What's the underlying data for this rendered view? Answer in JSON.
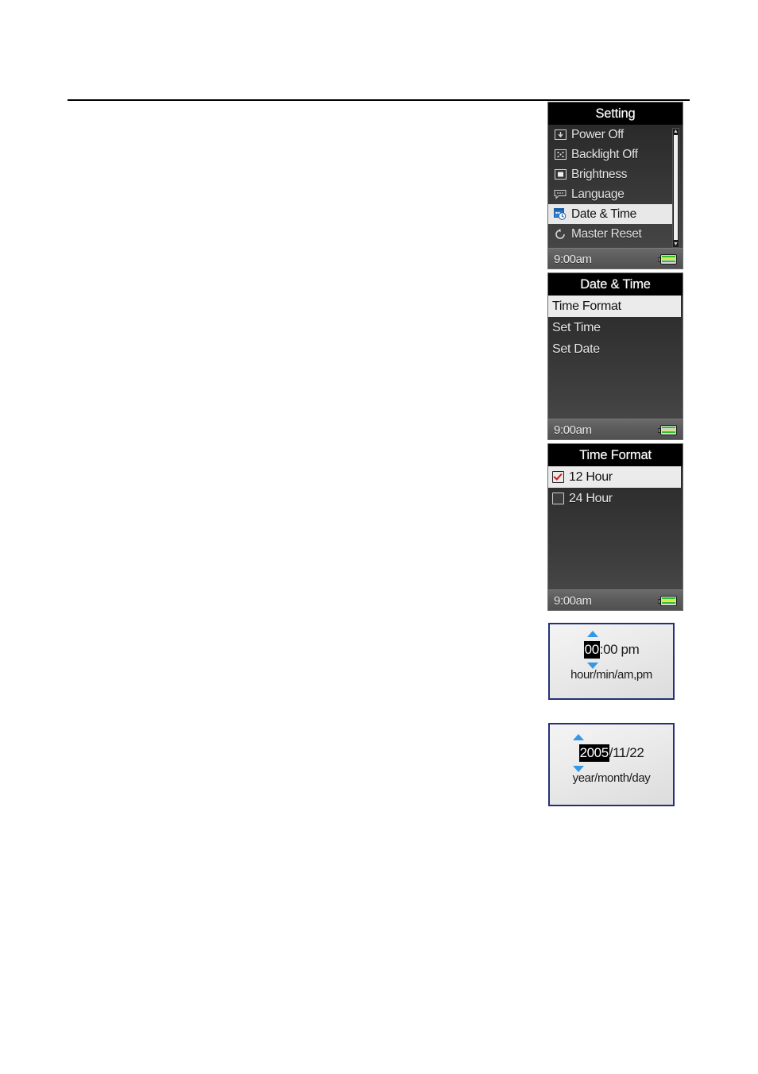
{
  "page": {
    "rule": "horizontal-rule"
  },
  "screens": [
    {
      "id": "setting",
      "title": "Setting",
      "items": [
        {
          "icon": "power-off-icon",
          "label": "Power Off",
          "selected": false
        },
        {
          "icon": "backlight-off-icon",
          "label": "Backlight Off",
          "selected": false
        },
        {
          "icon": "brightness-icon",
          "label": "Brightness",
          "selected": false
        },
        {
          "icon": "language-icon",
          "label": "Language",
          "selected": false
        },
        {
          "icon": "date-time-icon",
          "label": "Date & Time",
          "selected": true
        },
        {
          "icon": "master-reset-icon",
          "label": "Master Reset",
          "selected": false
        }
      ],
      "scrollbar": {
        "up": "▲",
        "down": "▼"
      },
      "status": {
        "time": "9:00am",
        "battery": "battery-full-icon"
      }
    },
    {
      "id": "date-time",
      "title": "Date & Time",
      "items": [
        {
          "label": "Time Format",
          "selected": true
        },
        {
          "label": "Set Time",
          "selected": false
        },
        {
          "label": "Set Date",
          "selected": false
        }
      ],
      "status": {
        "time": "9:00am",
        "battery": "battery-full-icon"
      }
    },
    {
      "id": "time-format",
      "title": "Time Format",
      "items": [
        {
          "label": "12 Hour",
          "checked": true,
          "selected": true
        },
        {
          "label": "24 Hour",
          "checked": false,
          "selected": false
        }
      ],
      "status": {
        "time": "9:00am",
        "battery": "battery-full-icon"
      }
    }
  ],
  "callouts": [
    {
      "id": "set-time-callout",
      "highlight": "00",
      "rest": ":00 pm",
      "caption": "hour/min/am,pm"
    },
    {
      "id": "set-date-callout",
      "highlight": "2005",
      "rest": "/11/22",
      "caption": "year/month/day"
    }
  ],
  "colors": {
    "accent_blue": "#3399e6",
    "callout_border": "#26307a",
    "check_red": "#d01616",
    "battery_green": "#2fbf2f",
    "selected_row": "#e8e8e8"
  }
}
